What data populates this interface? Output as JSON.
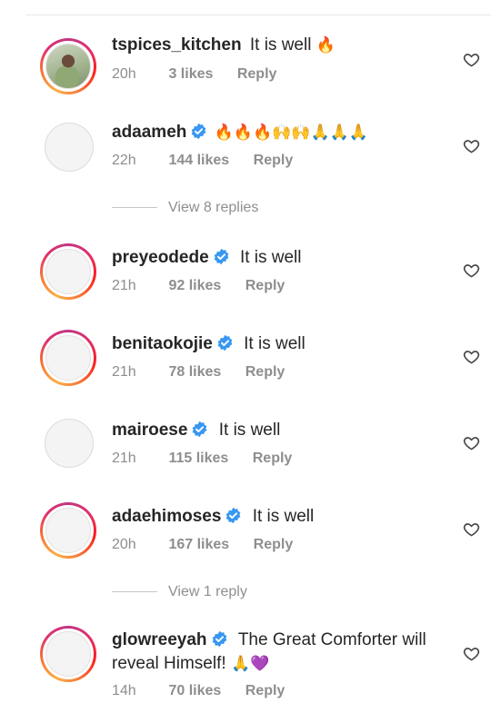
{
  "comments": [
    {
      "username": "tspices_kitchen",
      "verified": false,
      "text": "It is well",
      "emoji": "🔥",
      "time": "20h",
      "likes": "3 likes",
      "reply": "Reply",
      "avatar": "photo"
    },
    {
      "username": "adaameh",
      "verified": true,
      "text": "",
      "emoji": "🔥🔥🔥🙌🙌🙏🙏🙏",
      "time": "22h",
      "likes": "144 likes",
      "reply": "Reply",
      "avatar": "plain"
    },
    {
      "username": "preyeodede",
      "verified": true,
      "text": "It is well",
      "emoji": "",
      "time": "21h",
      "likes": "92 likes",
      "reply": "Reply",
      "avatar": "ring"
    },
    {
      "username": "benitaokojie",
      "verified": true,
      "text": "It is well",
      "emoji": "",
      "time": "21h",
      "likes": "78 likes",
      "reply": "Reply",
      "avatar": "ring"
    },
    {
      "username": "mairoese",
      "verified": true,
      "text": "It is well",
      "emoji": "",
      "time": "21h",
      "likes": "115 likes",
      "reply": "Reply",
      "avatar": "plain"
    },
    {
      "username": "adaehimoses",
      "verified": true,
      "text": "It is well",
      "emoji": "",
      "time": "20h",
      "likes": "167 likes",
      "reply": "Reply",
      "avatar": "ring"
    },
    {
      "username": "glowreeyah",
      "verified": true,
      "text": "The Great Comforter will",
      "text2": "reveal Himself!",
      "emoji": "🙏💜",
      "time": "14h",
      "likes": "70 likes",
      "reply": "Reply",
      "avatar": "ring"
    }
  ],
  "view_replies": [
    "View 8 replies",
    "View 1 reply"
  ],
  "colors": {
    "verified": "#3897f0",
    "muted": "#8e8e8e",
    "text": "#262626"
  }
}
